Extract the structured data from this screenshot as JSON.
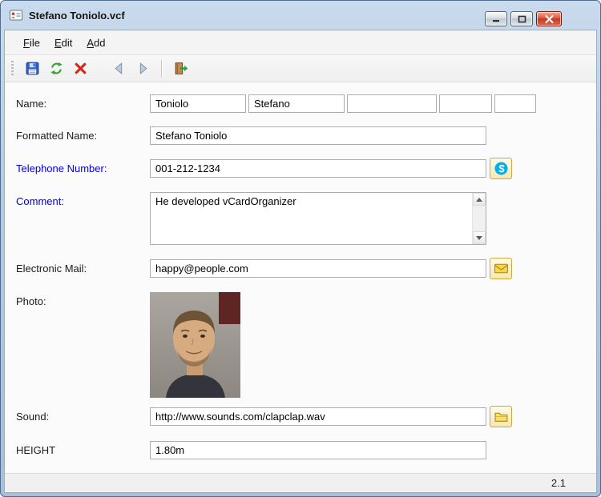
{
  "window": {
    "title": "Stefano Toniolo.vcf"
  },
  "menu": {
    "items": [
      {
        "mnemonic": "F",
        "rest": "ile"
      },
      {
        "mnemonic": "E",
        "rest": "dit"
      },
      {
        "mnemonic": "A",
        "rest": "dd"
      }
    ]
  },
  "toolbar": {
    "icons": [
      "save-icon",
      "refresh-icon",
      "delete-icon",
      "previous-icon",
      "next-icon",
      "exit-icon"
    ]
  },
  "form": {
    "name": {
      "label": "Name:",
      "values": [
        "Toniolo",
        "Stefano",
        "",
        "",
        ""
      ]
    },
    "formatted_name": {
      "label": "Formatted Name:",
      "value": "Stefano Toniolo"
    },
    "telephone": {
      "label": "Telephone Number:",
      "value": "001-212-1234",
      "action_icon": "skype-icon"
    },
    "comment": {
      "label": "Comment:",
      "value": "He developed vCardOrganizer"
    },
    "email": {
      "label": "Electronic Mail:",
      "value": "happy@people.com",
      "action_icon": "email-icon"
    },
    "photo": {
      "label": "Photo:"
    },
    "sound": {
      "label": "Sound:",
      "value": "http://www.sounds.com/clapclap.wav",
      "action_icon": "folder-icon"
    },
    "height": {
      "label": "HEIGHT",
      "value": "1.80m"
    }
  },
  "statusbar": {
    "version": "2.1"
  },
  "colors": {
    "titlebar_blue": "#b4cbe2",
    "label_link_blue": "#0000e0",
    "close_button_red": "#c03a22",
    "skype_blue": "#00aff0",
    "envelope_yellow": "#f8d74f",
    "folder_yellow": "#f9df6f"
  }
}
